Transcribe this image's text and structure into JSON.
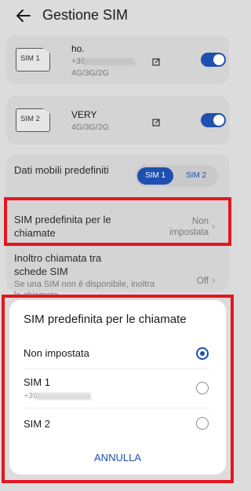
{
  "header": {
    "title": "Gestione SIM",
    "back_icon": "arrow-left-icon"
  },
  "sims": [
    {
      "chip": "SIM 1",
      "name": "ho.",
      "number": "+39",
      "networks": "4G/3G/2G",
      "enabled": true
    },
    {
      "chip": "SIM 2",
      "name": "VERY",
      "number": "",
      "networks": "4G/3G/2G",
      "enabled": true
    }
  ],
  "data_default": {
    "label": "Dati mobili predefiniti",
    "options": [
      "SIM 1",
      "SIM 2"
    ],
    "selected": "SIM 1"
  },
  "call_default": {
    "label": "SIM predefinita per le chiamate",
    "value": "Non impostata"
  },
  "forwarding": {
    "label": "Inoltro chiamata tra schede SIM",
    "description": "Se una SIM non è disponibile, inoltra le chiamate",
    "value": "Off"
  },
  "dialog": {
    "title": "SIM predefinita per le chiamate",
    "options": [
      {
        "label": "Non impostata",
        "sub": "",
        "selected": true
      },
      {
        "label": "SIM 1",
        "sub": "+39",
        "selected": false
      },
      {
        "label": "SIM 2",
        "sub": "",
        "selected": false
      }
    ],
    "cancel": "ANNULLA"
  },
  "colors": {
    "accent": "#1f4fb0",
    "highlight": "#e4161f"
  }
}
